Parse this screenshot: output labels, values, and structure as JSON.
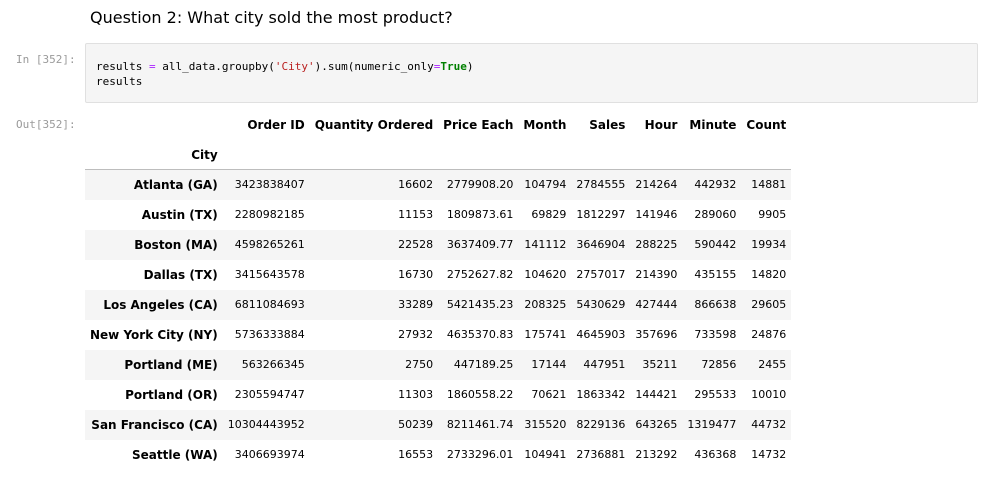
{
  "heading": "Question 2: What city sold the most product?",
  "cell": {
    "in_prompt": "In [352]:",
    "out_prompt": "Out[352]:",
    "code": {
      "line1": {
        "var": "results",
        "op_eq": "=",
        "call1": "all_data.groupby(",
        "arg_str": "'City'",
        "call2": ").sum(numeric_only",
        "op_kw": "=",
        "kw_true": "True",
        "close": ")"
      },
      "line2": "results"
    }
  },
  "table": {
    "columns": [
      "Order ID",
      "Quantity Ordered",
      "Price Each",
      "Month",
      "Sales",
      "Hour",
      "Minute",
      "Count"
    ],
    "index_name": "City",
    "rows": [
      {
        "city": "Atlanta (GA)",
        "values": [
          "3423838407",
          "16602",
          "2779908.20",
          "104794",
          "2784555",
          "214264",
          "442932",
          "14881"
        ]
      },
      {
        "city": "Austin (TX)",
        "values": [
          "2280982185",
          "11153",
          "1809873.61",
          "69829",
          "1812297",
          "141946",
          "289060",
          "9905"
        ]
      },
      {
        "city": "Boston (MA)",
        "values": [
          "4598265261",
          "22528",
          "3637409.77",
          "141112",
          "3646904",
          "288225",
          "590442",
          "19934"
        ]
      },
      {
        "city": "Dallas (TX)",
        "values": [
          "3415643578",
          "16730",
          "2752627.82",
          "104620",
          "2757017",
          "214390",
          "435155",
          "14820"
        ]
      },
      {
        "city": "Los Angeles (CA)",
        "values": [
          "6811084693",
          "33289",
          "5421435.23",
          "208325",
          "5430629",
          "427444",
          "866638",
          "29605"
        ]
      },
      {
        "city": "New York City (NY)",
        "values": [
          "5736333884",
          "27932",
          "4635370.83",
          "175741",
          "4645903",
          "357696",
          "733598",
          "24876"
        ]
      },
      {
        "city": "Portland (ME)",
        "values": [
          "563266345",
          "2750",
          "447189.25",
          "17144",
          "447951",
          "35211",
          "72856",
          "2455"
        ]
      },
      {
        "city": "Portland (OR)",
        "values": [
          "2305594747",
          "11303",
          "1860558.22",
          "70621",
          "1863342",
          "144421",
          "295533",
          "10010"
        ]
      },
      {
        "city": "San Francisco (CA)",
        "values": [
          "10304443952",
          "50239",
          "8211461.74",
          "315520",
          "8229136",
          "643265",
          "1319477",
          "44732"
        ]
      },
      {
        "city": "Seattle (WA)",
        "values": [
          "3406693974",
          "16553",
          "2733296.01",
          "104941",
          "2736881",
          "213292",
          "436368",
          "14732"
        ]
      }
    ]
  }
}
